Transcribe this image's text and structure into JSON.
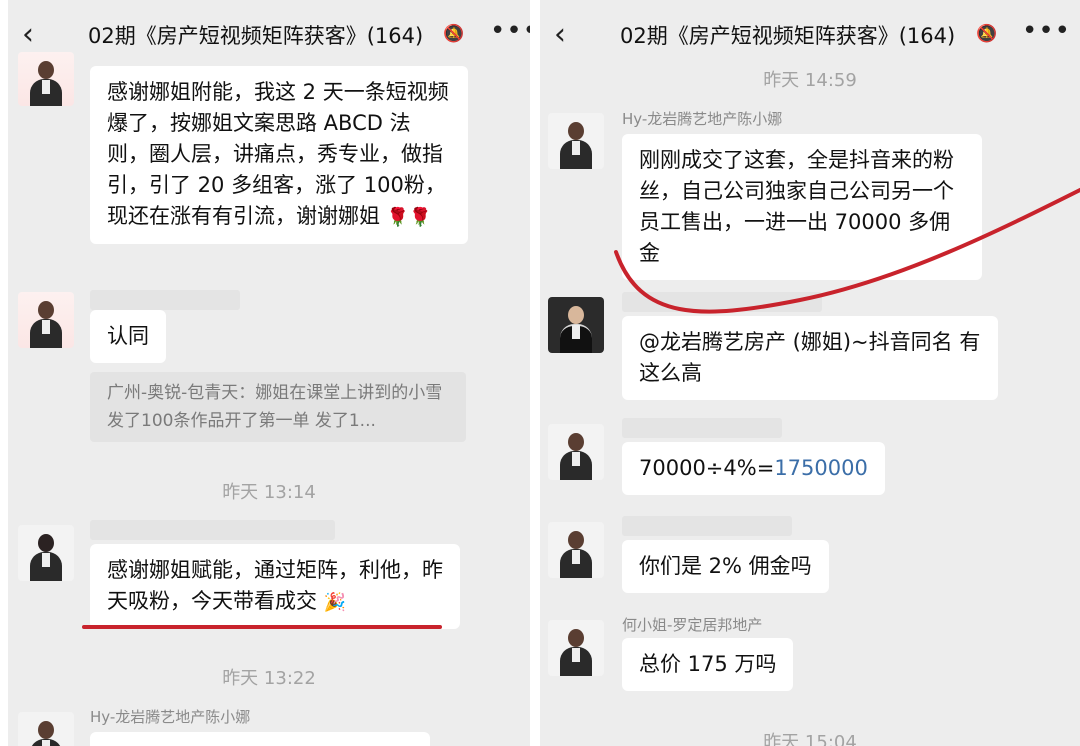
{
  "chat_title": "02期《房产短视频矩阵获客》(164)",
  "mute_icon": "bell-off-icon",
  "more_icon": "more-icon",
  "back_icon": "back-chevron-icon",
  "accent_color": "#c8232c",
  "left": {
    "messages": [
      {
        "text": "感谢娜姐附能，我这 2 天一条短视频爆了，按娜姐文案思路 ABCD 法则，圈人层，讲痛点，秀专业，做指引，引了 20 多组客，涨了 100粉，现还在涨有有引流，谢谢娜姐",
        "emoji": "🌹🌹"
      },
      {
        "text": "认同"
      },
      {
        "quote": "广州-奥锐-包青天：娜姐在课堂上讲到的小雪 发了100条作品开了第一单 发了1..."
      },
      {
        "time": "昨天 13:14"
      },
      {
        "text": "感谢娜姐赋能，通过矩阵，利他，昨天吸粉，今天带看成交",
        "emoji": "🎉"
      },
      {
        "time": "昨天 13:22"
      },
      {
        "sender": "Hy-龙岩腾艺地产陈小娜"
      }
    ]
  },
  "right": {
    "messages": [
      {
        "time": "昨天 14:59"
      },
      {
        "sender": "Hy-龙岩腾艺地产陈小娜",
        "text": "刚刚成交了这套，全是抖音来的粉丝，自己公司独家自己公司另一个员工售出，一进一出 70000 多佣金"
      },
      {
        "text": "@龙岩腾艺房产 (娜姐)~抖音同名 有这么高"
      },
      {
        "text": "70000÷4%=",
        "highlight": "1750000"
      },
      {
        "text": "你们是 2% 佣金吗"
      },
      {
        "sender": "何小姐-罗定居邦地产",
        "text": "总价 175 万吗"
      },
      {
        "time": "昨天 15:04"
      }
    ]
  }
}
